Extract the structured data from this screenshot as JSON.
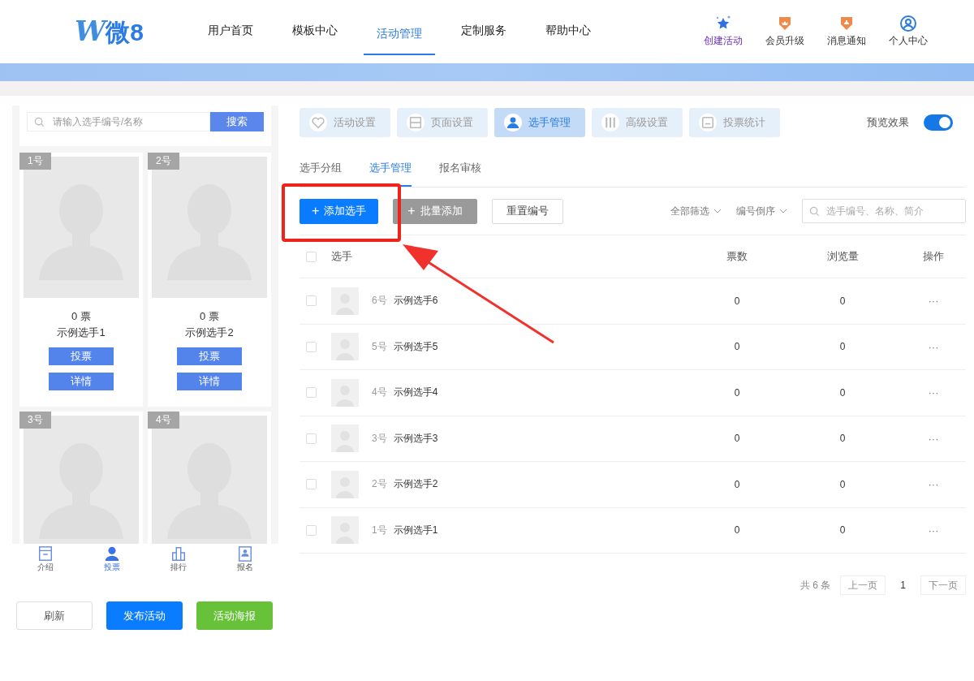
{
  "header": {
    "logo": {
      "mark": "W",
      "text": "微8"
    },
    "nav": [
      {
        "label": "用户首页",
        "selected": false
      },
      {
        "label": "模板中心",
        "selected": false
      },
      {
        "label": "活动管理",
        "selected": true
      },
      {
        "label": "定制服务",
        "selected": false
      },
      {
        "label": "帮助中心",
        "selected": false
      }
    ],
    "actions": [
      {
        "kind": "create",
        "label": "创建活动"
      },
      {
        "kind": "upgrade",
        "label": "会员升级"
      },
      {
        "kind": "notice",
        "label": "消息通知"
      },
      {
        "kind": "user",
        "label": "个人中心"
      }
    ]
  },
  "preview": {
    "search": {
      "placeholder": "请输入选手编号/名称",
      "button": "搜索"
    },
    "players": [
      {
        "number": "1号",
        "votes": "0 票",
        "name": "示例选手1",
        "buttons": [
          "投票",
          "详情"
        ]
      },
      {
        "number": "2号",
        "votes": "0 票",
        "name": "示例选手2",
        "buttons": [
          "投票",
          "详情"
        ]
      },
      {
        "number": "3号"
      },
      {
        "number": "4号"
      }
    ],
    "bottom_nav": [
      {
        "kind": "intro",
        "label": "介绍",
        "selected": false
      },
      {
        "kind": "vote",
        "label": "投票",
        "selected": true
      },
      {
        "kind": "rank",
        "label": "排行",
        "selected": false
      },
      {
        "kind": "signup",
        "label": "报名",
        "selected": false
      }
    ],
    "buttons": [
      {
        "kind": "plain",
        "label": "刷新"
      },
      {
        "kind": "primary",
        "label": "发布活动"
      },
      {
        "kind": "success",
        "label": "活动海报"
      }
    ]
  },
  "settings_tabs": [
    {
      "kind": "heart",
      "label": "活动设置",
      "selected": false
    },
    {
      "kind": "page",
      "label": "页面设置",
      "selected": false
    },
    {
      "kind": "person",
      "label": "选手管理",
      "selected": true
    },
    {
      "kind": "tools",
      "label": "高级设置",
      "selected": false
    },
    {
      "kind": "stats",
      "label": "投票统计",
      "selected": false
    }
  ],
  "preview_toggle": {
    "label": "预览效果",
    "on": true
  },
  "sub_tabs": [
    {
      "label": "选手分组",
      "selected": false
    },
    {
      "label": "选手管理",
      "selected": true
    },
    {
      "label": "报名审核",
      "selected": false
    }
  ],
  "toolbar": {
    "buttons": [
      {
        "kind": "primary",
        "icon": "+",
        "label": "添加选手"
      },
      {
        "kind": "gray",
        "icon": "+",
        "label": "批量添加"
      },
      {
        "kind": "plain",
        "label": "重置编号"
      }
    ],
    "filters": [
      {
        "label": "全部筛选"
      },
      {
        "label": "编号倒序"
      }
    ],
    "search": {
      "placeholder": "选手编号、名称、简介"
    }
  },
  "table": {
    "select_all": {
      "checked": false
    },
    "columns": [
      "选手",
      "票数",
      "浏览量",
      "操作"
    ],
    "rows": [
      {
        "checked": false,
        "number": "6号",
        "name": "示例选手6",
        "votes": "0",
        "views": "0",
        "action": "···"
      },
      {
        "checked": false,
        "number": "5号",
        "name": "示例选手5",
        "votes": "0",
        "views": "0",
        "action": "···"
      },
      {
        "checked": false,
        "number": "4号",
        "name": "示例选手4",
        "votes": "0",
        "views": "0",
        "action": "···"
      },
      {
        "checked": false,
        "number": "3号",
        "name": "示例选手3",
        "votes": "0",
        "views": "0",
        "action": "···"
      },
      {
        "checked": false,
        "number": "2号",
        "name": "示例选手2",
        "votes": "0",
        "views": "0",
        "action": "···"
      },
      {
        "checked": false,
        "number": "1号",
        "name": "示例选手1",
        "votes": "0",
        "views": "0",
        "action": "···"
      }
    ]
  },
  "pagination": {
    "total": "共 6 条",
    "prev": "上一页",
    "page": "1",
    "next": "下一页"
  },
  "annotations": {
    "frame": true,
    "arrow": true
  }
}
